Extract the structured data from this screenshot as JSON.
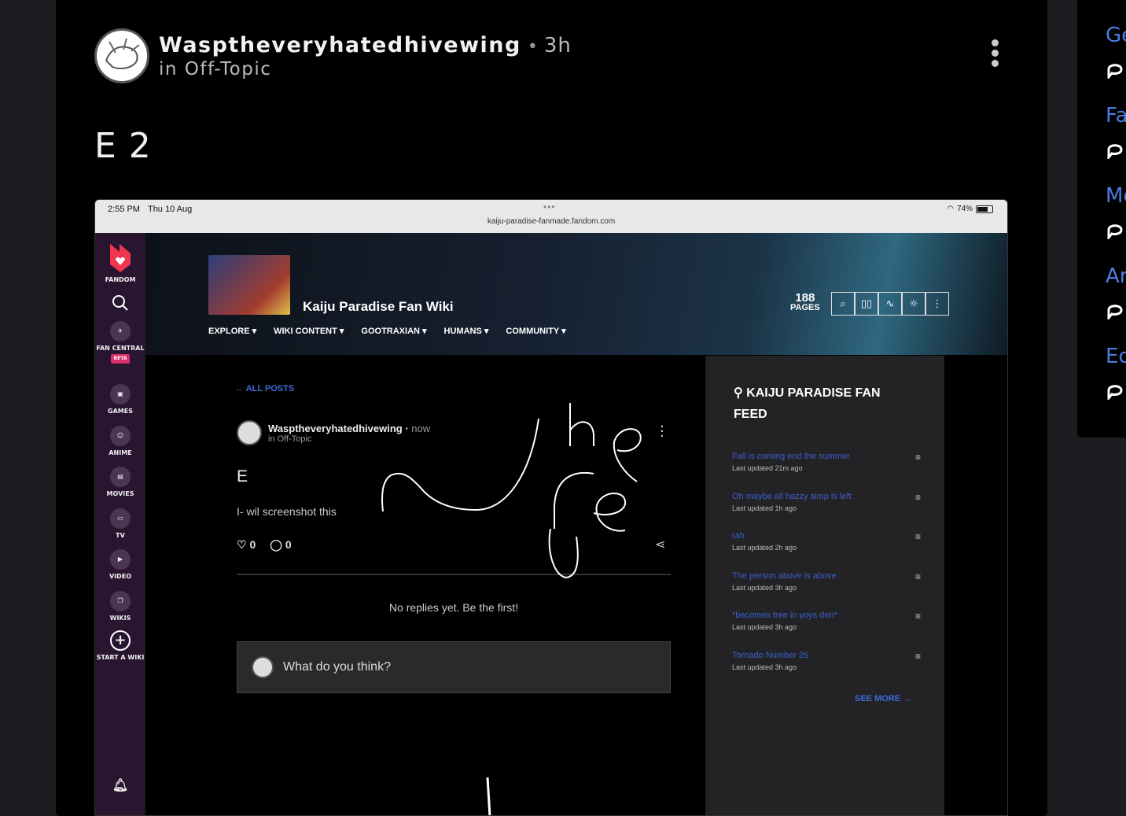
{
  "post": {
    "author": "Wasptheveryhatedhivewing",
    "separator": "•",
    "time": "3h",
    "community": "in Off-Topic",
    "title": "E 2"
  },
  "screenshot": {
    "status_time": "2:55 PM",
    "status_date": "Thu 10 Aug",
    "url": "kaiju-paradise-fanmade.fandom.com",
    "battery": "74%",
    "sidebar": {
      "fandom": "FANDOM",
      "fan_central": "FAN CENTRAL",
      "beta": "BETA",
      "games": "GAMES",
      "anime": "ANIME",
      "movies": "MOVIES",
      "tv": "TV",
      "video": "VIDEO",
      "wikis": "WIKIS",
      "start_a_wiki": "START A WIKI"
    },
    "wiki": {
      "name": "Kaiju Paradise Fan Wiki",
      "nav": [
        "EXPLORE",
        "WIKI CONTENT",
        "GOOTRAXIAN",
        "HUMANS",
        "COMMUNITY"
      ],
      "pages_count": "188",
      "pages_label": "PAGES"
    },
    "inner_post": {
      "back": "ALL POSTS",
      "author": "Wasptheveryhatedhivewing",
      "time": "now",
      "community": "in Off-Topic",
      "title": "E",
      "body": "I- wil screenshot this",
      "likes": "0",
      "comments": "0",
      "no_replies": "No replies yet. Be the first!",
      "reply_placeholder": "What do you think?"
    },
    "feed": {
      "title": "KAIJU PARADISE FAN FEED",
      "items": [
        {
          "title": "Fall is coming end the summer",
          "updated": "Last updated 21m ago"
        },
        {
          "title": "Oh maybe all hazzy simp is left",
          "updated": "Last updated 1h ago"
        },
        {
          "title": "rah",
          "updated": "Last updated 2h ago"
        },
        {
          "title": "The person above is above :",
          "updated": "Last updated 3h ago"
        },
        {
          "title": "*becomes tree in yoys den*",
          "updated": "Last updated 3h ago"
        },
        {
          "title": "Tornado Number 26",
          "updated": "Last updated 3h ago"
        }
      ],
      "see_more": "SEE MORE →"
    }
  },
  "right_strip": {
    "items": [
      "Ge",
      "Fa",
      "Mc",
      "Ar",
      "Ec"
    ]
  },
  "colors": {
    "accent_link": "#3f69d8",
    "fandom_sidebar": "#2a1530",
    "card_bg": "#000000"
  }
}
